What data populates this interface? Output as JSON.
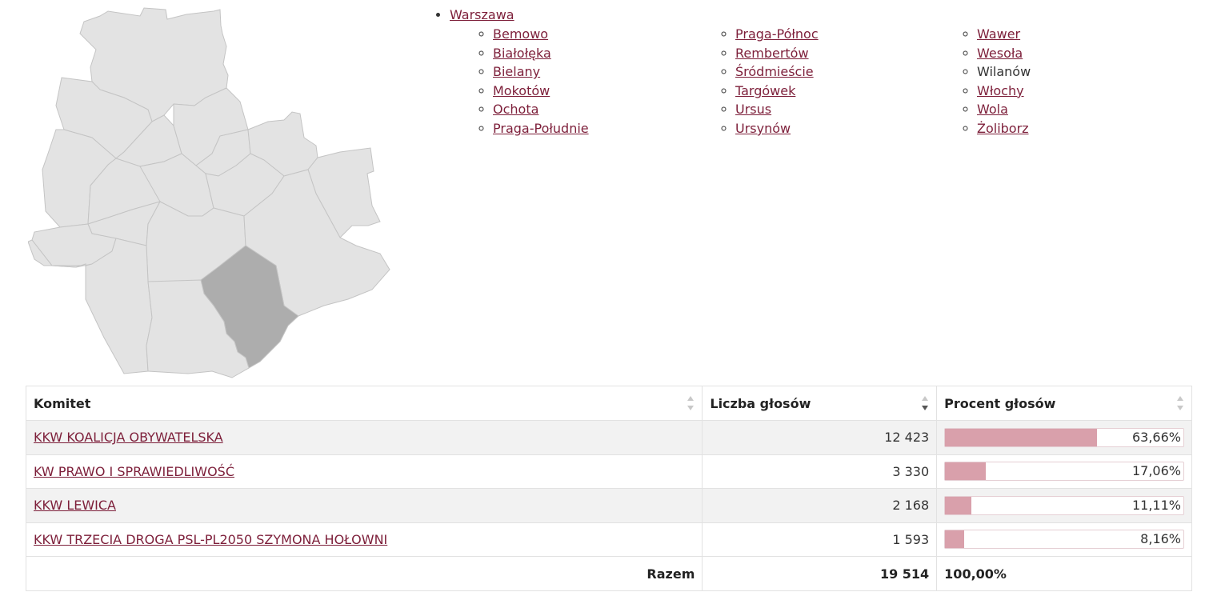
{
  "region": {
    "city_label": "Warszawa",
    "districts": [
      [
        {
          "label": "Bemowo",
          "link": true
        },
        {
          "label": "Białołęka",
          "link": true
        },
        {
          "label": "Bielany",
          "link": true
        },
        {
          "label": "Mokotów",
          "link": true
        },
        {
          "label": "Ochota",
          "link": true
        },
        {
          "label": "Praga-Południe",
          "link": true
        }
      ],
      [
        {
          "label": "Praga-Północ",
          "link": true
        },
        {
          "label": "Rembertów",
          "link": true
        },
        {
          "label": "Śródmieście",
          "link": true
        },
        {
          "label": "Targówek",
          "link": true
        },
        {
          "label": "Ursus",
          "link": true
        },
        {
          "label": "Ursynów",
          "link": true
        }
      ],
      [
        {
          "label": "Wawer",
          "link": true
        },
        {
          "label": "Wesoła",
          "link": true
        },
        {
          "label": "Wilanów",
          "link": false
        },
        {
          "label": "Włochy",
          "link": true
        },
        {
          "label": "Wola",
          "link": true
        },
        {
          "label": "Żoliborz",
          "link": true
        }
      ]
    ],
    "selected_district": "Wilanów"
  },
  "colors": {
    "link": "#7d1f3a",
    "map_fill": "#e3e3e3",
    "map_selected": "#adadad",
    "bar_fill": "#d9a0ab"
  },
  "table": {
    "headers": {
      "committee": "Komitet",
      "votes": "Liczba głosów",
      "percent": "Procent głosów"
    },
    "sorted_column": "votes",
    "rows": [
      {
        "committee": "KKW KOALICJA OBYWATELSKA",
        "votes": "12 423",
        "percent": "63,66%",
        "share": 0.6366
      },
      {
        "committee": "KW PRAWO I SPRAWIEDLIWOŚĆ",
        "votes": "3 330",
        "percent": "17,06%",
        "share": 0.1706
      },
      {
        "committee": "KKW LEWICA",
        "votes": "2 168",
        "percent": "11,11%",
        "share": 0.1111
      },
      {
        "committee": "KKW TRZECIA DROGA PSL-PL2050 SZYMONA HOŁOWNI",
        "votes": "1 593",
        "percent": "8,16%",
        "share": 0.0816
      }
    ],
    "total": {
      "label": "Razem",
      "votes": "19 514",
      "percent": "100,00%"
    }
  }
}
